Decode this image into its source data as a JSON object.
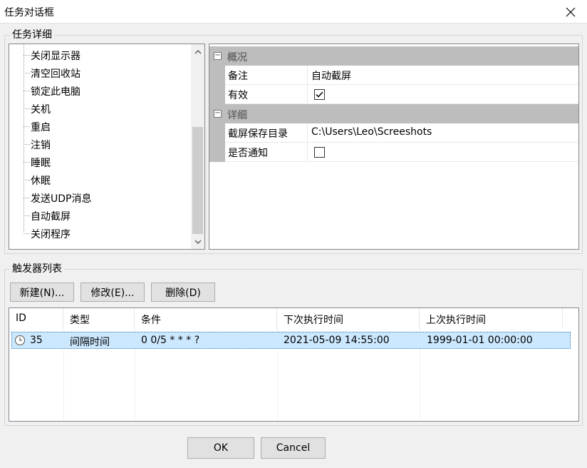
{
  "window": {
    "title": "任务对话框"
  },
  "task_details": {
    "group_label": "任务详细",
    "tree_items": [
      {
        "label": "关闭显示器"
      },
      {
        "label": "清空回收站"
      },
      {
        "label": "锁定此电脑"
      },
      {
        "label": "关机"
      },
      {
        "label": "重启"
      },
      {
        "label": "注销"
      },
      {
        "label": "睡眠"
      },
      {
        "label": "休眠"
      },
      {
        "label": "发送UDP消息"
      },
      {
        "label": "自动截屏"
      },
      {
        "label": "关闭程序"
      }
    ],
    "properties": {
      "categories": [
        {
          "label": "概况",
          "rows": [
            {
              "name": "备注",
              "value": "自动截屏"
            },
            {
              "name": "有效",
              "checked": true
            }
          ]
        },
        {
          "label": "详细",
          "rows": [
            {
              "name": "截屏保存目录",
              "value": "C:\\Users\\Leo\\Screeshots"
            },
            {
              "name": "是否通知",
              "checked": false
            }
          ]
        }
      ],
      "toggle_symbol": "−"
    }
  },
  "trigger_list": {
    "group_label": "触发器列表",
    "buttons": {
      "new": "新建(N)...",
      "edit": "修改(E)...",
      "delete": "删除(D)"
    },
    "columns": [
      "ID",
      "类型",
      "条件",
      "下次执行时间",
      "上次执行时间"
    ],
    "rows": [
      {
        "id": "35",
        "type": "间隔时间",
        "condition": "0 0/5 * * * ?",
        "next_run": "2021-05-09 14:55:00",
        "last_run": "1999-01-01 00:00:00",
        "icon": "clock-icon"
      }
    ]
  },
  "footer": {
    "ok": "OK",
    "cancel": "Cancel"
  },
  "colors": {
    "selection": "#cce8ff",
    "category_bg": "#bdbdbd",
    "window_bg": "#f0f0f0"
  }
}
